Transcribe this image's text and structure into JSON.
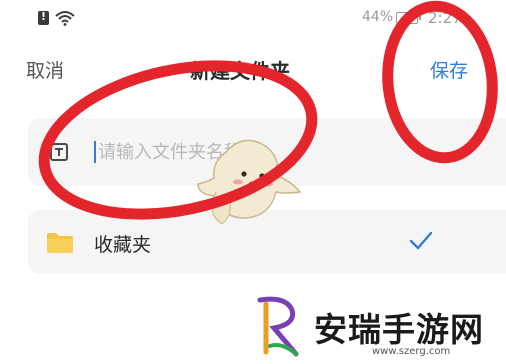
{
  "status_bar": {
    "battery_percent": "44%",
    "time": "2:27",
    "icons": [
      "sim-alert-icon",
      "wifi-icon",
      "battery-icon"
    ]
  },
  "nav": {
    "cancel_label": "取消",
    "title": "新建文件夹",
    "save_label": "保存"
  },
  "name_input": {
    "value": "",
    "placeholder": "请输入文件夹名称",
    "icon": "folder-tag-icon"
  },
  "folder_list": [
    {
      "label": "收藏夹",
      "icon": "folder-icon",
      "selected": true,
      "selected_icon": "check-icon"
    }
  ],
  "watermark": {
    "brand": "安瑞手游网",
    "url": "www.szerg.com"
  },
  "colors": {
    "accent": "#2f7fd8",
    "annotation": "#e4262c",
    "folder": "#f6c343",
    "card_bg": "#f5f5f5"
  }
}
